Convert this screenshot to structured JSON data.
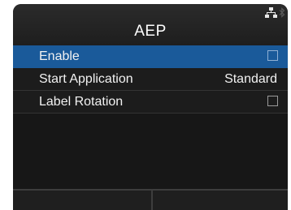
{
  "header": {
    "title": "AEP"
  },
  "status_icons": [
    "network-icon",
    "bluetooth-icon"
  ],
  "menu": {
    "items": [
      {
        "label": "Enable",
        "type": "checkbox",
        "checked": false,
        "selected": true
      },
      {
        "label": "Start Application",
        "value": "Standard",
        "type": "value",
        "selected": false
      },
      {
        "label": "Label Rotation",
        "type": "checkbox",
        "checked": false,
        "selected": false
      }
    ]
  },
  "colors": {
    "selection": "#1a5a9a",
    "background": "#171717"
  }
}
